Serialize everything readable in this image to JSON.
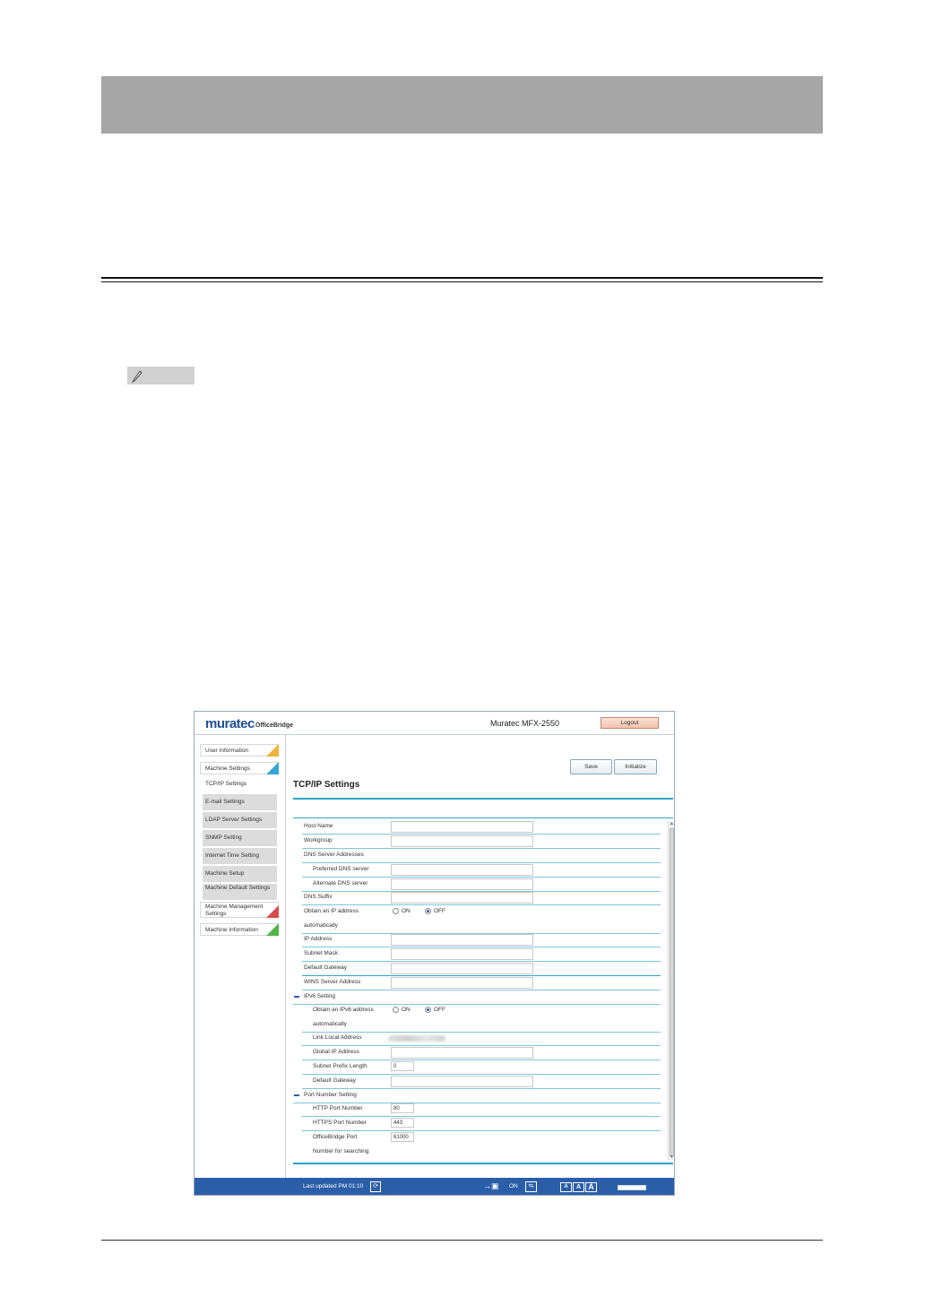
{
  "screen": {
    "logo": "muratec",
    "logo_sub": "OfficeBridge",
    "model": "Muratec MFX-2550",
    "logout_label": "Logout",
    "sidebar": {
      "user_information": "User Information",
      "machine_settings": "Machine Settings",
      "sub_items": [
        "TCP/IP Settings",
        "E-mail Settings",
        "LDAP Server Settings",
        "SNMP Setting",
        "Internet Time Setting",
        "Machine Setup",
        "Machine Default Settings"
      ],
      "machine_management_settings": "Machine Management Settings",
      "machine_information": "Machine Information"
    },
    "buttons": {
      "save": "Save",
      "initialize": "Initialize"
    },
    "page_title": "TCP/IP Settings",
    "form": {
      "host_name": "Host Name",
      "workgroup": "Workgroup",
      "dns_server_addresses": "DNS Server Addresses",
      "preferred_dns": "Preferred DNS server",
      "alternate_dns": "Alternate DNS server",
      "dns_suffix": "DNS Suffix",
      "obtain_ip": "Obtain an IP address",
      "obtain_ip_2": "automatically",
      "on": "ON",
      "off": "OFF",
      "ip_address": "IP Address",
      "subnet_mask": "Subnet Mask",
      "default_gateway": "Default Gateway",
      "wins_server": "WINS Server Address",
      "ipv6_setting": "IPv6 Setting",
      "obtain_ipv6": "Obtain an IPv6 address",
      "obtain_ipv6_2": "automatically",
      "link_local": "Link Local Address",
      "global_ip": "Global IP Address",
      "subnet_prefix": "Subnet Prefix Length",
      "subnet_prefix_value": "0",
      "default_gateway_v6": "Default Gateway",
      "port_number_setting": "Port Number Setting",
      "http_port": "HTTP Port Number",
      "http_port_value": "80",
      "https_port": "HTTPS Port Number",
      "https_port_value": "443",
      "officebridge_port": "OfficeBridge Port",
      "officebridge_port_value": "61000",
      "number_for_searching": "Number for searching"
    },
    "status_bar": {
      "last_updated": "Last updated PM 01:10",
      "connection_state": "ON",
      "font_sizes": [
        "A",
        "A",
        "A"
      ]
    },
    "icons": [
      "refresh-icon",
      "connection-icon",
      "swap-icon",
      "note-pencil-icon"
    ]
  }
}
